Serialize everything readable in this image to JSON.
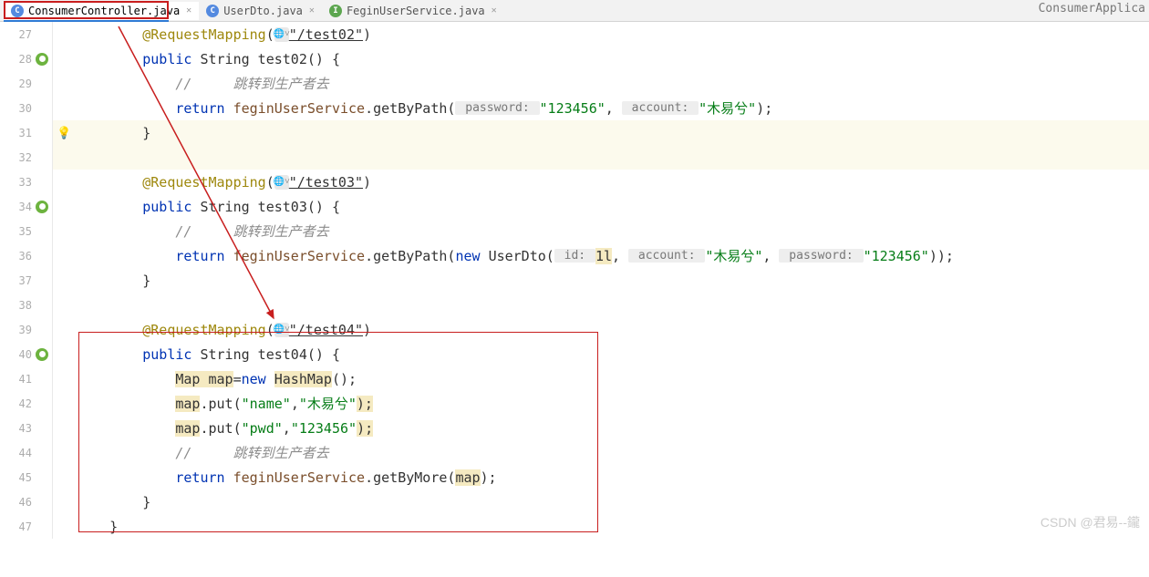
{
  "top_right_partial": "ConsumerApplica",
  "tabs": [
    {
      "label": "ConsumerController.java",
      "icon": "C"
    },
    {
      "label": "UserDto.java",
      "icon": "C"
    },
    {
      "label": "FeginUserService.java",
      "icon": "I"
    }
  ],
  "lines": [
    {
      "num": "27",
      "tokens": [
        {
          "indent": 2
        },
        {
          "t": "@RequestMapping",
          "c": "anno"
        },
        {
          "t": "("
        },
        {
          "globe": true
        },
        {
          "t": "\"/test02\"",
          "c": "str underln"
        },
        {
          "t": ")"
        }
      ]
    },
    {
      "num": "28",
      "spring": true,
      "tokens": [
        {
          "indent": 2
        },
        {
          "t": "public ",
          "c": "kw"
        },
        {
          "t": "String test02() {"
        }
      ]
    },
    {
      "num": "29",
      "tokens": [
        {
          "indent": 3
        },
        {
          "t": "//     跳转到生产者去",
          "c": "cmt"
        }
      ]
    },
    {
      "num": "30",
      "tokens": [
        {
          "indent": 3
        },
        {
          "t": "return ",
          "c": "kw"
        },
        {
          "t": "feginUserService",
          "c": "mtd"
        },
        {
          "t": ".getByPath("
        },
        {
          "hint": " password: "
        },
        {
          "t": "\"123456\"",
          "c": "str"
        },
        {
          "t": ", "
        },
        {
          "hint": " account: "
        },
        {
          "t": "\"木易兮\"",
          "c": "str"
        },
        {
          "t": ");"
        }
      ]
    },
    {
      "num": "31",
      "bulb": true,
      "highlight": true,
      "tokens": [
        {
          "indent": 2
        },
        {
          "t": "}"
        }
      ]
    },
    {
      "num": "32",
      "highlight": true,
      "tokens": []
    },
    {
      "num": "33",
      "tokens": [
        {
          "indent": 2
        },
        {
          "t": "@RequestMapping",
          "c": "anno"
        },
        {
          "t": "("
        },
        {
          "globe": true
        },
        {
          "t": "\"/test03\"",
          "c": "str underln"
        },
        {
          "t": ")"
        }
      ]
    },
    {
      "num": "34",
      "spring": true,
      "tokens": [
        {
          "indent": 2
        },
        {
          "t": "public ",
          "c": "kw"
        },
        {
          "t": "String test03() {"
        }
      ]
    },
    {
      "num": "35",
      "tokens": [
        {
          "indent": 3
        },
        {
          "t": "//     跳转到生产者去",
          "c": "cmt"
        }
      ]
    },
    {
      "num": "36",
      "tokens": [
        {
          "indent": 3
        },
        {
          "t": "return ",
          "c": "kw"
        },
        {
          "t": "feginUserService",
          "c": "mtd"
        },
        {
          "t": ".getByPath("
        },
        {
          "t": "new ",
          "c": "kw"
        },
        {
          "t": "UserDto("
        },
        {
          "hint": " id: "
        },
        {
          "t": "1l",
          "c": "yellowbg"
        },
        {
          "t": ", "
        },
        {
          "hint": " account: "
        },
        {
          "t": "\"木易兮\"",
          "c": "str"
        },
        {
          "t": ", "
        },
        {
          "hint": " password: "
        },
        {
          "t": "\"123456\"",
          "c": "str"
        },
        {
          "t": "));"
        }
      ]
    },
    {
      "num": "37",
      "tokens": [
        {
          "indent": 2
        },
        {
          "t": "}"
        }
      ]
    },
    {
      "num": "38",
      "tokens": []
    },
    {
      "num": "39",
      "tokens": [
        {
          "indent": 2
        },
        {
          "t": "@RequestMapping",
          "c": "anno"
        },
        {
          "t": "("
        },
        {
          "globe": true
        },
        {
          "t": "\"/test04\"",
          "c": "str underln"
        },
        {
          "t": ")"
        }
      ]
    },
    {
      "num": "40",
      "spring": true,
      "tokens": [
        {
          "indent": 2
        },
        {
          "t": "public ",
          "c": "kw"
        },
        {
          "t": "String test04() {"
        }
      ]
    },
    {
      "num": "41",
      "tokens": [
        {
          "indent": 3
        },
        {
          "t": "Map ",
          "c": "yellowbg"
        },
        {
          "t": "map",
          "c": "yellowbg"
        },
        {
          "t": "="
        },
        {
          "t": "new ",
          "c": "kw"
        },
        {
          "t": "HashMap",
          "c": "yellowbg"
        },
        {
          "t": "();"
        }
      ]
    },
    {
      "num": "42",
      "tokens": [
        {
          "indent": 3
        },
        {
          "t": "map",
          "c": "yellowbg"
        },
        {
          "t": ".put("
        },
        {
          "t": "\"name\"",
          "c": "str"
        },
        {
          "t": ","
        },
        {
          "t": "\"木易兮\"",
          "c": "str"
        },
        {
          "t": ");",
          "c": "yellowbg"
        }
      ]
    },
    {
      "num": "43",
      "tokens": [
        {
          "indent": 3
        },
        {
          "t": "map",
          "c": "yellowbg"
        },
        {
          "t": ".put("
        },
        {
          "t": "\"pwd\"",
          "c": "str"
        },
        {
          "t": ","
        },
        {
          "t": "\"123456\"",
          "c": "str"
        },
        {
          "t": ");",
          "c": "yellowbg"
        }
      ]
    },
    {
      "num": "44",
      "tokens": [
        {
          "indent": 3
        },
        {
          "t": "//     跳转到生产者去",
          "c": "cmt"
        }
      ]
    },
    {
      "num": "45",
      "tokens": [
        {
          "indent": 3
        },
        {
          "t": "return ",
          "c": "kw"
        },
        {
          "t": "feginUserService",
          "c": "mtd"
        },
        {
          "t": ".getByMore("
        },
        {
          "t": "map",
          "c": "yellowbg"
        },
        {
          "t": ");"
        }
      ]
    },
    {
      "num": "46",
      "tokens": [
        {
          "indent": 2
        },
        {
          "t": "}"
        }
      ]
    },
    {
      "num": "47",
      "tokens": [
        {
          "indent": 1
        },
        {
          "t": "}"
        }
      ]
    }
  ],
  "watermark": "CSDN @君易--鑨"
}
